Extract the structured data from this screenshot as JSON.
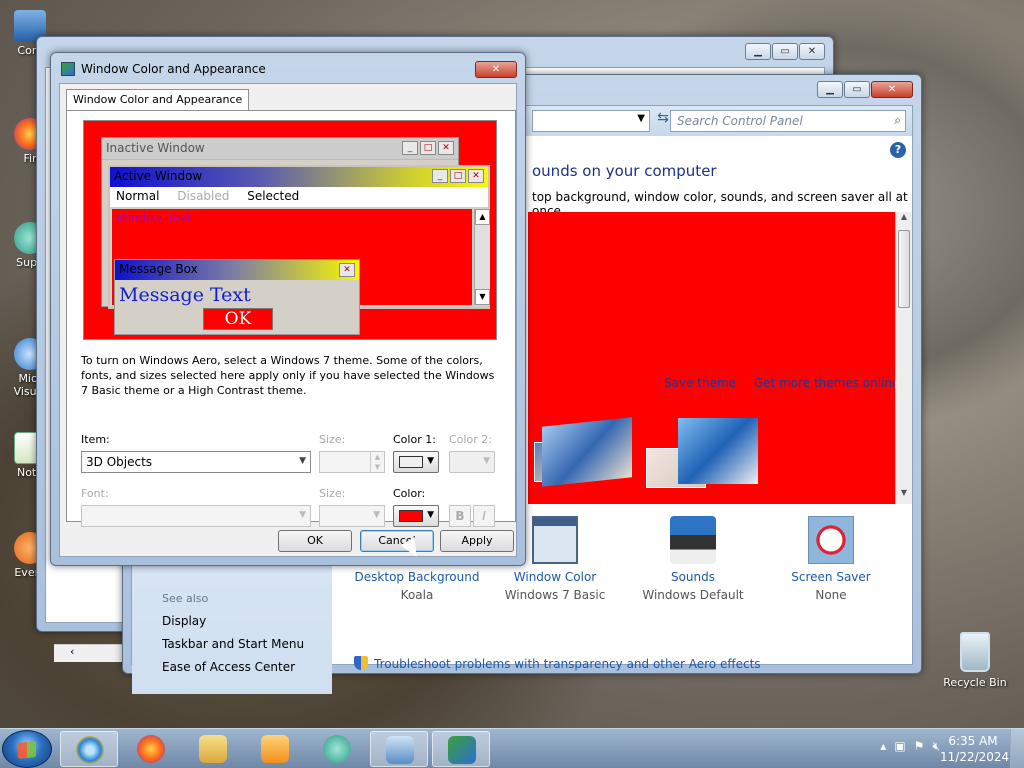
{
  "desktop": {
    "icons": [
      {
        "label": "Com"
      },
      {
        "label": "Fir"
      },
      {
        "label": "Supe"
      },
      {
        "label": "Micr Visual"
      },
      {
        "label": "Note"
      },
      {
        "label": "Every"
      }
    ],
    "recycle_bin": "Recycle Bin"
  },
  "control_panel": {
    "search_placeholder": "Search Control Panel",
    "heading": "ounds on your computer",
    "subtitle": "top background, window color, sounds, and screen saver all at once.",
    "theme_links": [
      "Save theme",
      "Get more themes online"
    ],
    "bottom_items": [
      {
        "label": "Desktop Background",
        "sub": "Koala"
      },
      {
        "label": "Window Color",
        "sub": "Windows 7 Basic"
      },
      {
        "label": "Sounds",
        "sub": "Windows Default"
      },
      {
        "label": "Screen Saver",
        "sub": "None"
      }
    ],
    "troubleshoot": "Troubleshoot problems with transparency and other Aero effects",
    "see_also": "See also",
    "see_also_links": [
      "Display",
      "Taskbar and Start Menu",
      "Ease of Access Center"
    ]
  },
  "dialog": {
    "title": "Window Color and Appearance",
    "tab": "Window Color and Appearance",
    "preview": {
      "inactive_title": "Inactive Window",
      "active_title": "Active Window",
      "menu_normal": "Normal",
      "menu_disabled": "Disabled",
      "menu_selected": "Selected",
      "window_text": "Window Text",
      "msgbox_title": "Message Box",
      "msgbox_text": "Message Text",
      "msgbox_ok": "OK"
    },
    "note": "To turn on Windows Aero, select a Windows 7 theme.  Some of the colors, fonts, and sizes selected here apply only if you have selected the Windows 7 Basic theme or a High Contrast theme.",
    "item_label": "Item:",
    "item_value": "3D Objects",
    "size_label": "Size:",
    "color1_label": "Color 1:",
    "color1_value": "#f0f0f0",
    "color2_label": "Color 2:",
    "font_label": "Font:",
    "size2_label": "Size:",
    "color_label": "Color:",
    "color_value": "#ff0000",
    "bold": "B",
    "italic": "I",
    "ok": "OK",
    "cancel": "Cancel",
    "apply": "Apply"
  },
  "taskbar": {
    "clock_time": "6:35 AM",
    "clock_date": "11/22/2024"
  }
}
